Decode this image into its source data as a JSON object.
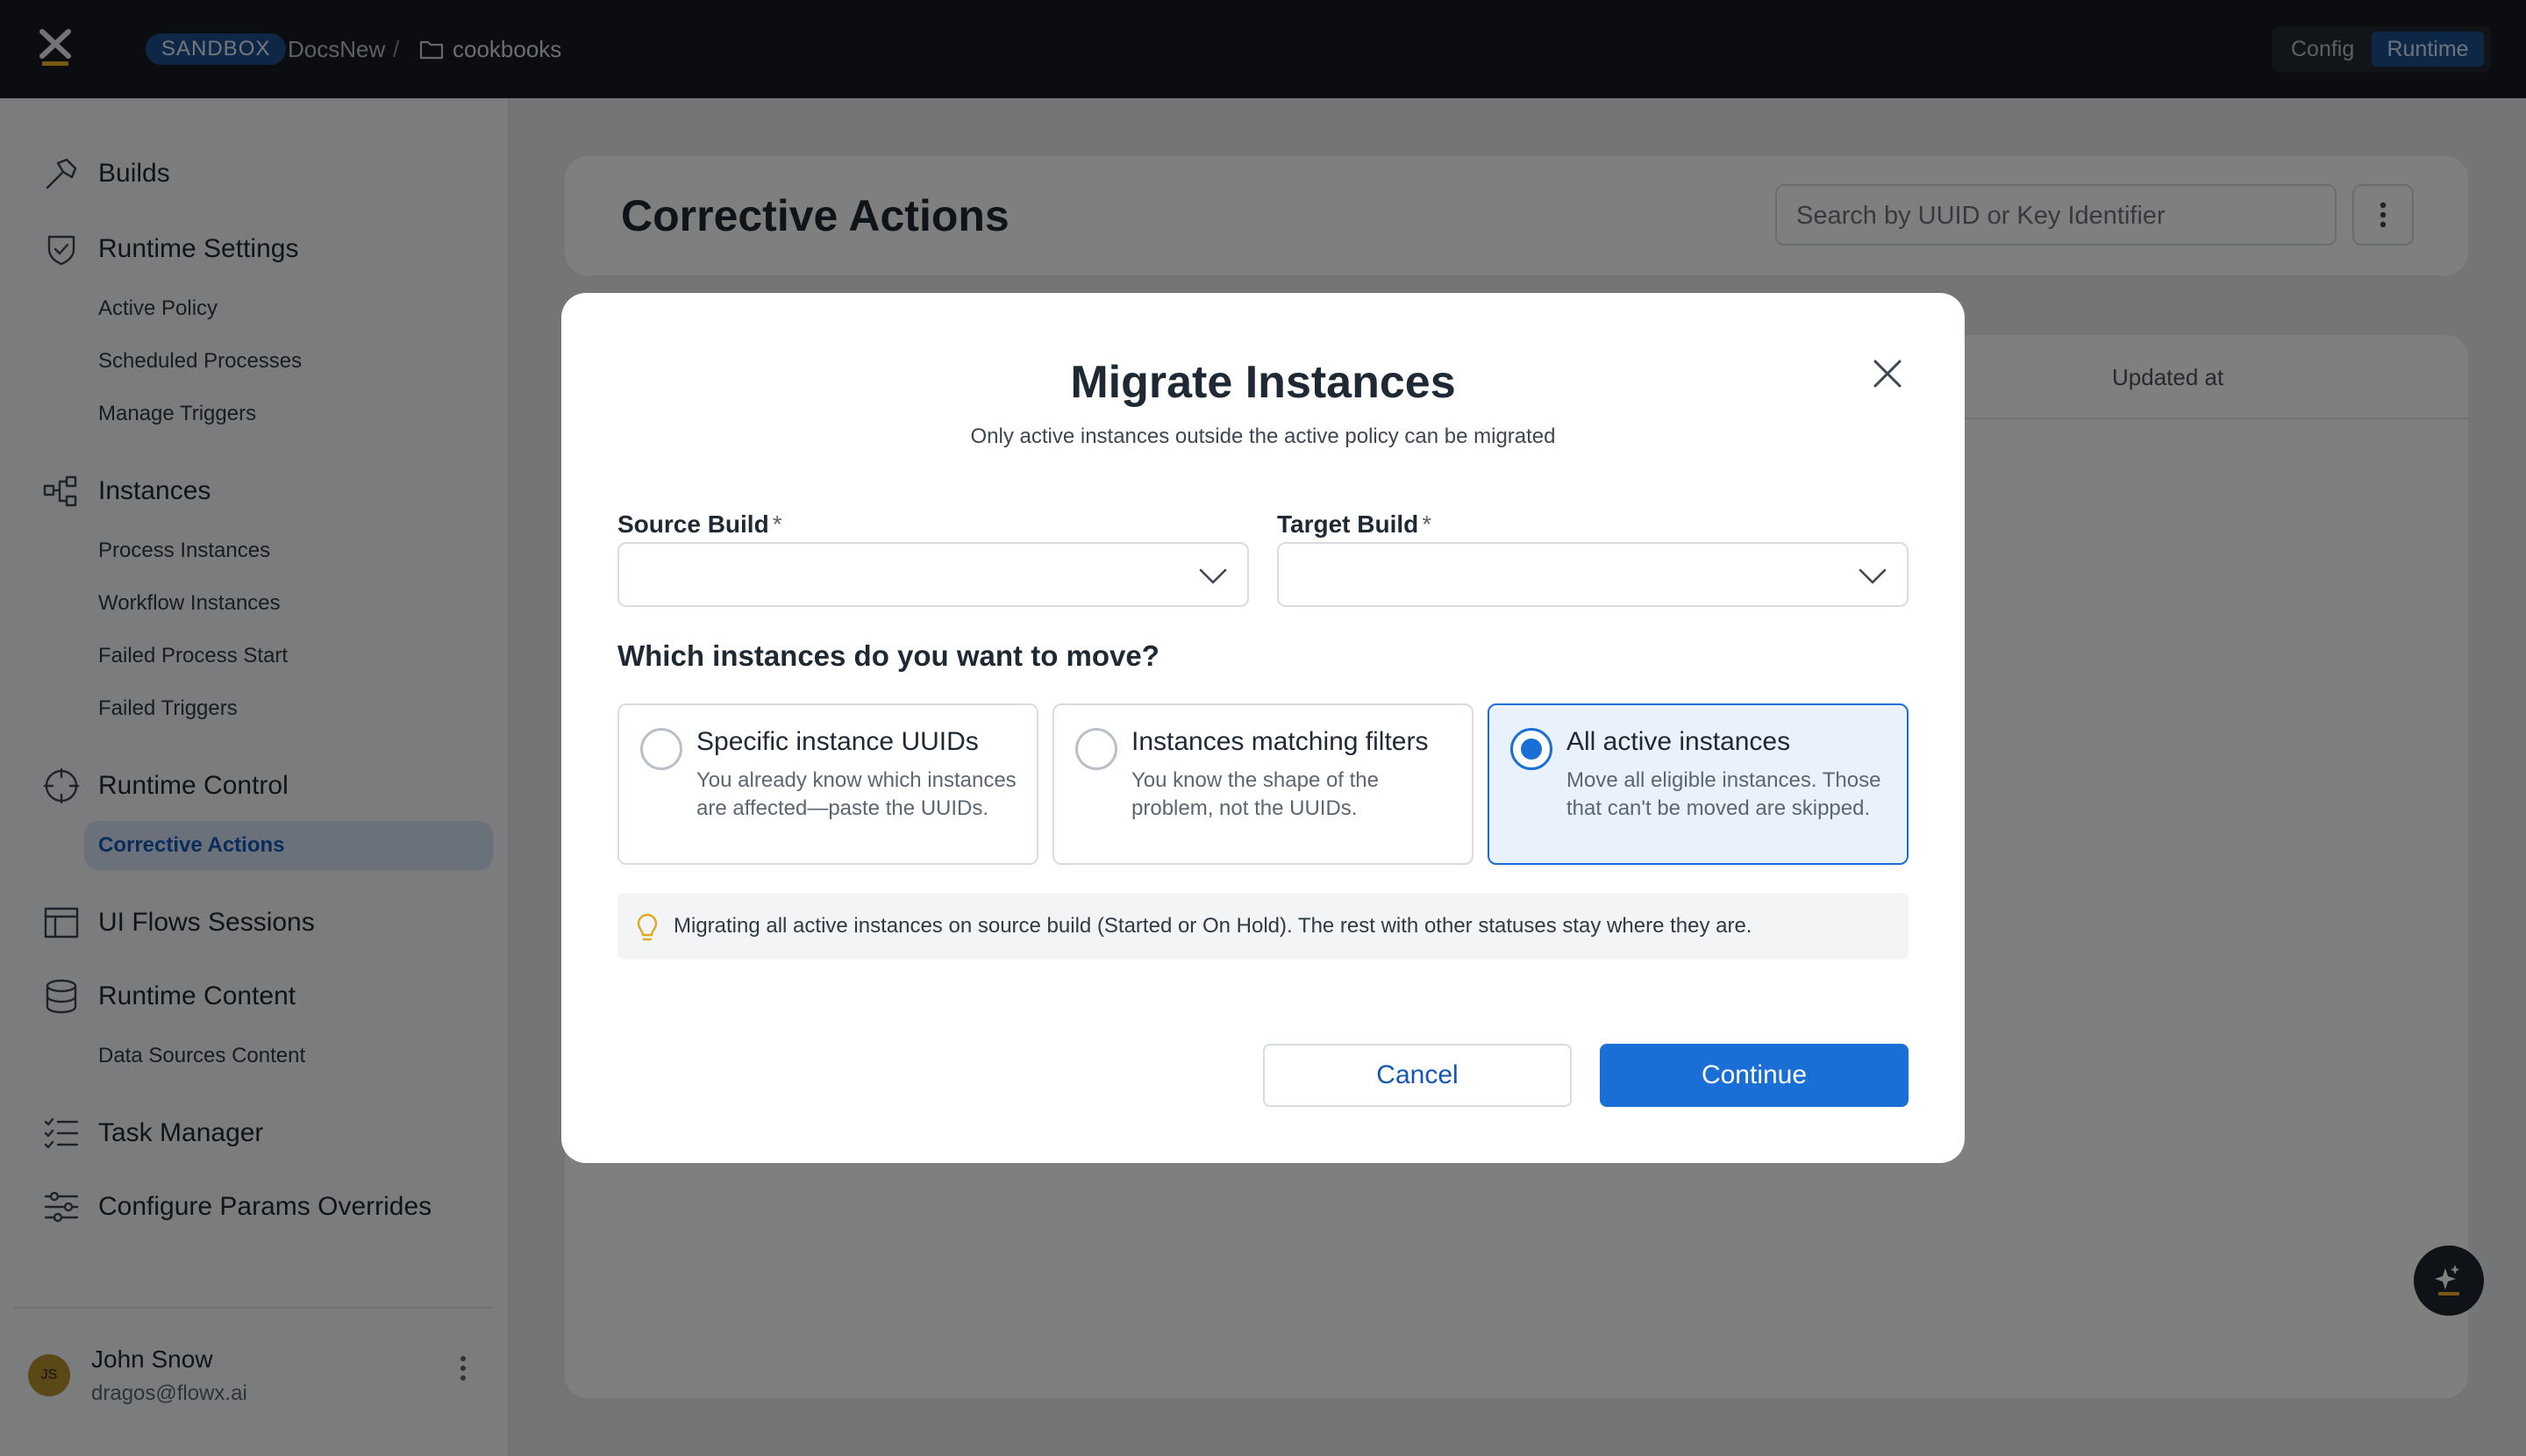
{
  "topbar": {
    "environment_badge": "SANDBOX",
    "project": "DocsNew",
    "separator": "/",
    "folder": "cookbooks",
    "mode_config": "Config",
    "mode_runtime": "Runtime"
  },
  "sidebar": {
    "sections": [
      {
        "label": "Builds",
        "icon": "hammer-icon"
      },
      {
        "label": "Runtime Settings",
        "icon": "shield-check-icon",
        "items": [
          "Active Policy",
          "Scheduled Processes",
          "Manage Triggers"
        ]
      },
      {
        "label": "Instances",
        "icon": "hierarchy-icon",
        "items": [
          "Process Instances",
          "Workflow Instances",
          "Failed Process Start",
          "Failed Triggers"
        ]
      },
      {
        "label": "Runtime Control",
        "icon": "crosshair-icon",
        "items": [
          "Corrective Actions"
        ],
        "active_item": "Corrective Actions"
      },
      {
        "label": "UI Flows Sessions",
        "icon": "layout-icon"
      },
      {
        "label": "Runtime Content",
        "icon": "database-icon",
        "items": [
          "Data Sources Content"
        ]
      },
      {
        "label": "Task Manager",
        "icon": "checklist-icon"
      },
      {
        "label": "Configure Params Overrides",
        "icon": "sliders-icon"
      }
    ],
    "user": {
      "initials": "JS",
      "name": "John Snow",
      "email": "dragos@flowx.ai"
    }
  },
  "main": {
    "title": "Corrective Actions",
    "search_placeholder": "Search by UUID or Key Identifier",
    "table_columns": [
      "Updated at"
    ]
  },
  "modal": {
    "title": "Migrate Instances",
    "subtitle": "Only active instances outside the active policy can be migrated",
    "source_label": "Source Build",
    "target_label": "Target Build",
    "required_marker": "*",
    "source_value": "",
    "target_value": "",
    "question": "Which instances do you want to move?",
    "options": [
      {
        "title": "Specific instance UUIDs",
        "description": "You already know which instances are affected—paste the UUIDs.",
        "selected": false
      },
      {
        "title": "Instances matching filters",
        "description": "You know the shape of the problem, not the UUIDs.",
        "selected": false
      },
      {
        "title": "All active instances",
        "description": "Move all eligible instances. Those that can't be moved are skipped.",
        "selected": true
      }
    ],
    "info": "Migrating all active instances on source build (Started or On Hold). The rest with other statuses stay where they are.",
    "cancel_label": "Cancel",
    "continue_label": "Continue"
  },
  "colors": {
    "accent": "#1a6fd6",
    "topbar_bg": "#161b22",
    "active_nav_bg": "#d5e3f4",
    "logo_accent": "#f0b323"
  }
}
